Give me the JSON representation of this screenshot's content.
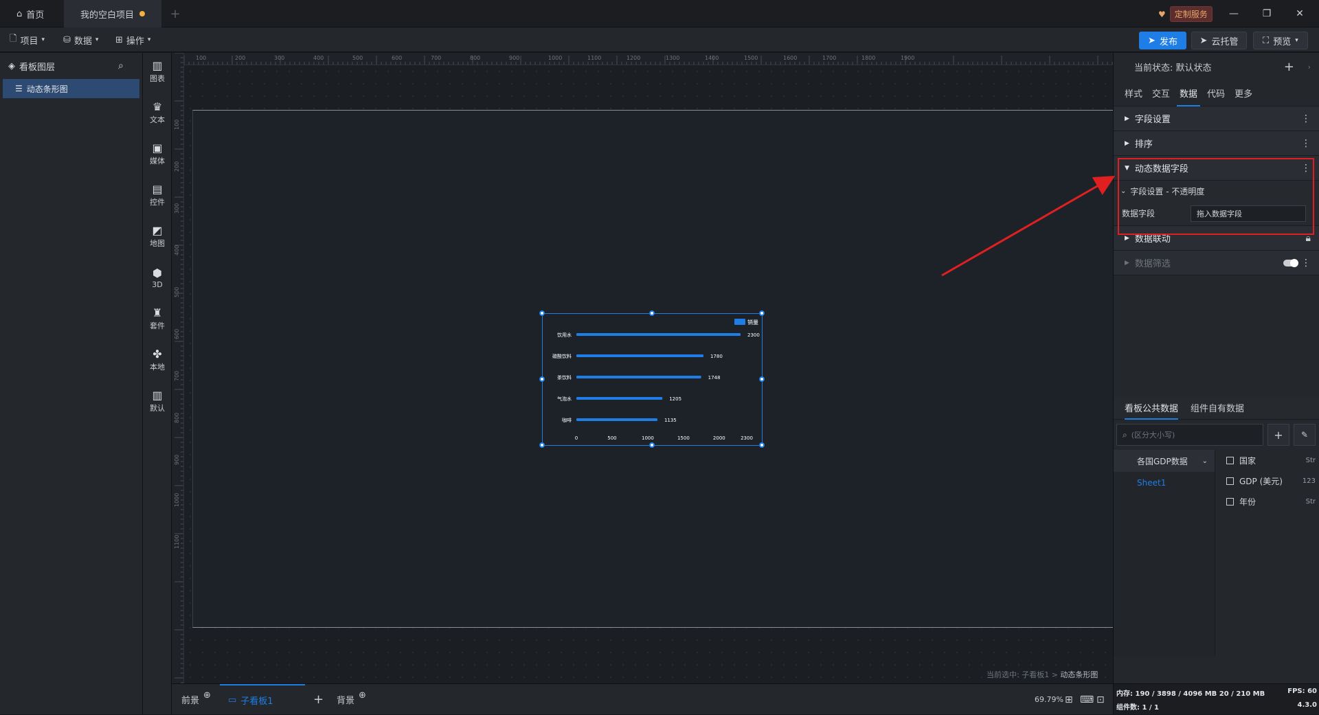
{
  "titlebar": {
    "home_tab": "首页",
    "project_tab": "我的空白项目",
    "service_badge": "定制服务"
  },
  "menubar": {
    "project": "项目",
    "data": "数据",
    "operate": "操作",
    "publish": "发布",
    "cloud": "云托管",
    "preview": "预览"
  },
  "layers": {
    "title": "看板图层",
    "items": [
      "动态条形图"
    ]
  },
  "components": [
    "图表",
    "文本",
    "媒体",
    "控件",
    "地图",
    "3D",
    "套件",
    "本地",
    "默认"
  ],
  "ruler": {
    "top": [
      "100",
      "200",
      "300",
      "400",
      "500",
      "600",
      "700",
      "800",
      "900",
      "1000",
      "1100",
      "1200",
      "1300",
      "1400",
      "1500",
      "1600",
      "1700",
      "1800",
      "1900"
    ],
    "left": [
      "100",
      "200",
      "300",
      "400",
      "500",
      "600",
      "700",
      "800",
      "900",
      "1000",
      "1100"
    ]
  },
  "chart_data": {
    "type": "bar",
    "orientation": "horizontal",
    "categories": [
      "饮用水",
      "碳酸饮料",
      "茶饮料",
      "气泡水",
      "咖啡"
    ],
    "series": [
      {
        "name": "销量",
        "values": [
          2300,
          1780,
          1748,
          1205,
          1135
        ]
      }
    ],
    "xticks": [
      "0",
      "500",
      "1000",
      "1500",
      "2000",
      "2300"
    ],
    "xlim": [
      0,
      2300
    ],
    "legend": "top-right",
    "color": "#1f7ee6"
  },
  "breadcrumb": {
    "prefix": "当前选中: 子看板1 > ",
    "current": "动态条形图"
  },
  "bottombar": {
    "foreground": "前景",
    "subboard": "子看板1",
    "background": "背景",
    "zoom": "69.79%"
  },
  "panel": {
    "state_label": "当前状态: 默认状态",
    "tabs": [
      "样式",
      "交互",
      "数据",
      "代码",
      "更多"
    ],
    "active_tab": "数据",
    "sections": {
      "field_settings": "字段设置",
      "sort": "排序",
      "dynamic_field": "动态数据字段",
      "sub_setting": "字段设置 - 不透明度",
      "data_field_label": "数据字段",
      "data_field_input": "拖入数据字段",
      "linkage": "数据联动",
      "filter": "数据筛选"
    },
    "data_tabs": [
      "看板公共数据",
      "组件自有数据"
    ],
    "search_placeholder": "(区分大小写)",
    "dataset": "各国GDP数据",
    "sheet": "Sheet1",
    "fields": [
      {
        "name": "国家",
        "type": "Str"
      },
      {
        "name": "GDP (美元)",
        "type": "123"
      },
      {
        "name": "年份",
        "type": "Str"
      }
    ]
  },
  "status": {
    "memory": "内存: 190 / 3898 / 4096 MB  20 / 210 MB",
    "fps": "FPS: 60",
    "count": "组件数: 1 / 1",
    "version": "4.3.0"
  },
  "colors": {
    "accent": "#1f7ee6",
    "highlight": "#e02020"
  }
}
